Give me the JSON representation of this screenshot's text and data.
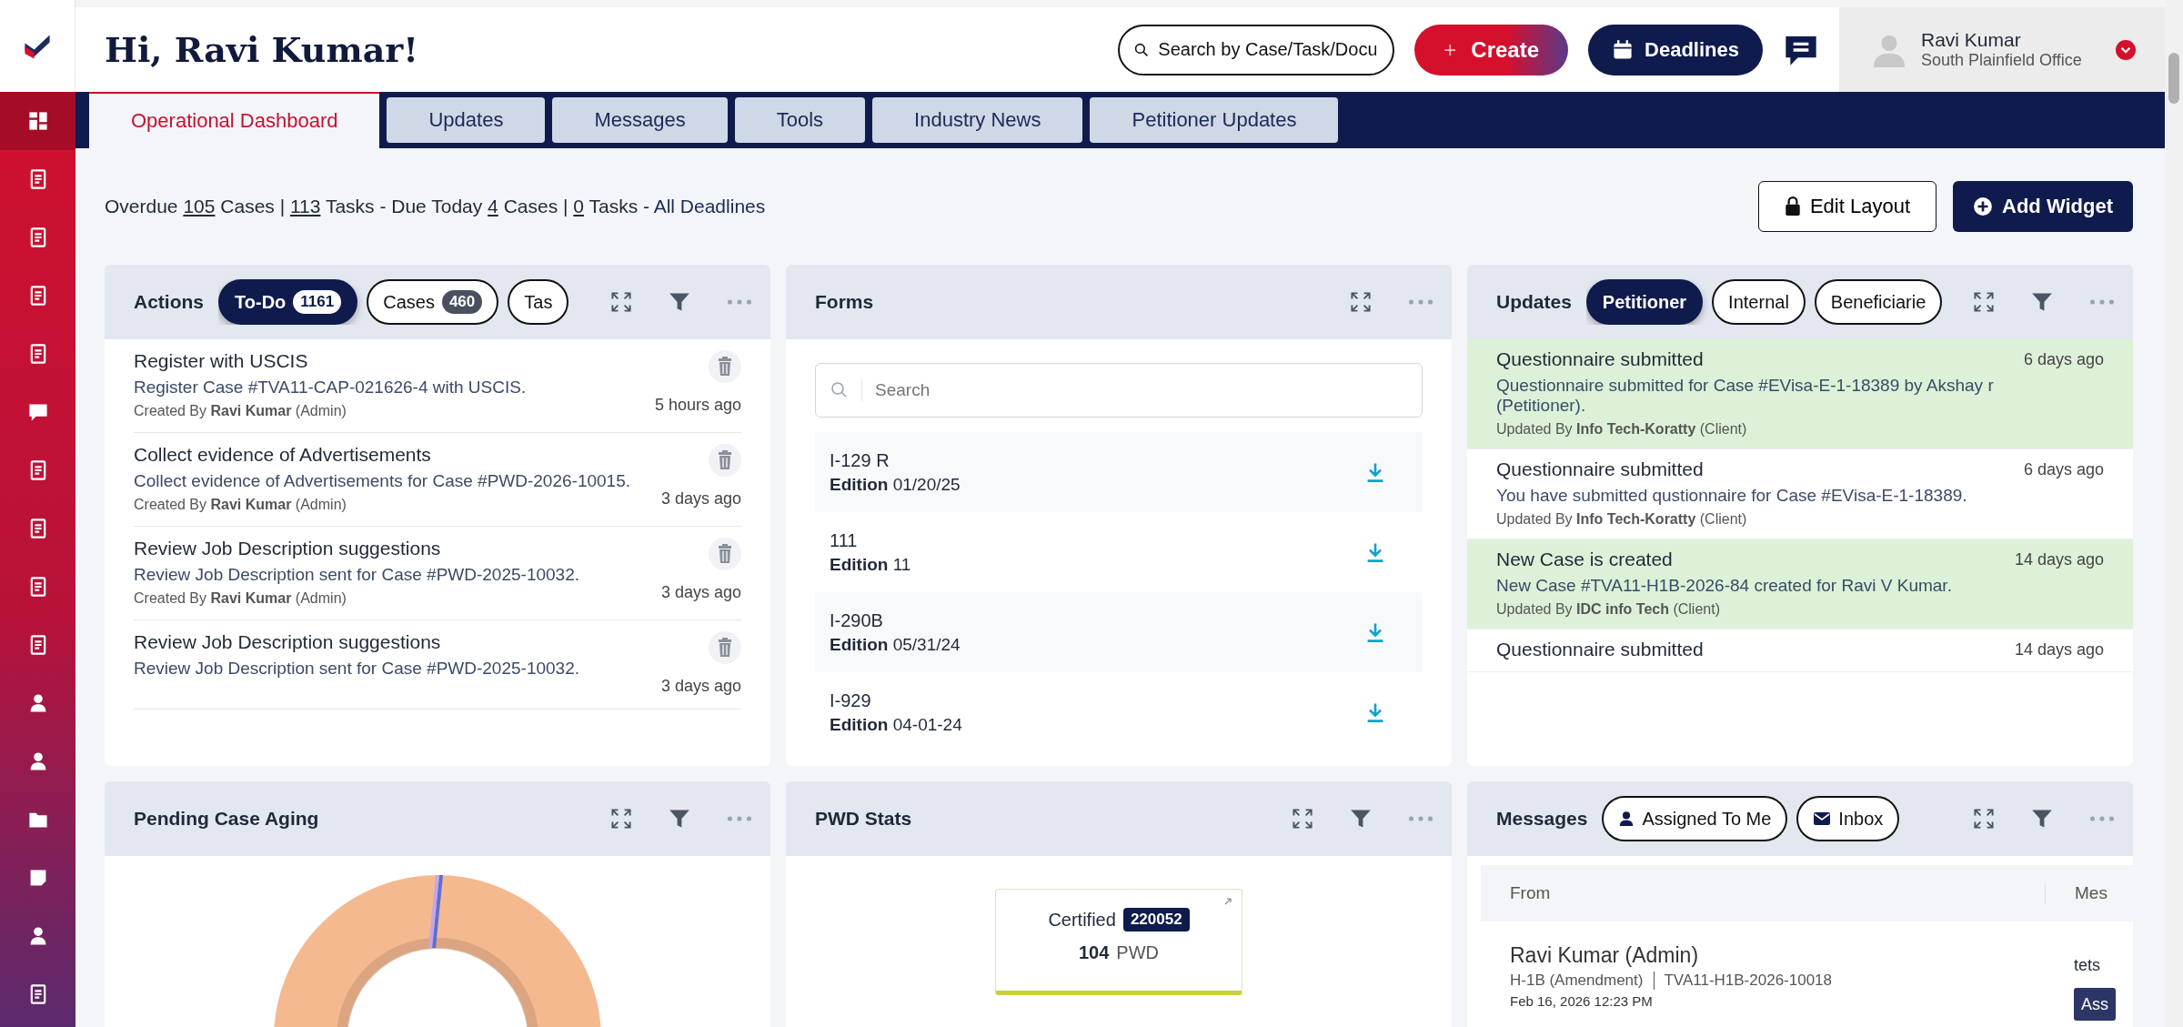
{
  "sidebar": {
    "items": [
      {
        "selected": true
      },
      {
        "selected": false
      },
      {
        "selected": false
      },
      {
        "selected": false
      },
      {
        "selected": false
      },
      {
        "selected": false
      },
      {
        "selected": false
      },
      {
        "selected": false
      },
      {
        "selected": false
      },
      {
        "selected": false
      },
      {
        "selected": false
      },
      {
        "selected": false
      },
      {
        "selected": false
      },
      {
        "selected": false
      },
      {
        "selected": false
      },
      {
        "selected": false
      }
    ]
  },
  "header": {
    "greeting": "Hi, Ravi Kumar!",
    "search": {
      "placeholder": "Search by Case/Task/Docu"
    },
    "create": "Create",
    "create_icon": "+",
    "deadlines": "Deadlines",
    "user": {
      "name": "Ravi Kumar",
      "office": "South Plainfield Office"
    }
  },
  "tabs": [
    {
      "label": "Operational Dashboard",
      "selected": true
    },
    {
      "label": "Updates",
      "selected": false
    },
    {
      "label": "Messages",
      "selected": false
    },
    {
      "label": "Tools",
      "selected": false
    },
    {
      "label": "Industry News",
      "selected": false
    },
    {
      "label": "Petitioner Updates",
      "selected": false
    }
  ],
  "summary": [
    {
      "kind": "text",
      "text": "Overdue"
    },
    {
      "kind": "count",
      "text": "105"
    },
    {
      "kind": "text",
      "text": "Cases |"
    },
    {
      "kind": "count",
      "text": "113"
    },
    {
      "kind": "text",
      "text": "Tasks - Due Today"
    },
    {
      "kind": "count",
      "text": "4"
    },
    {
      "kind": "text",
      "text": "Cases |"
    },
    {
      "kind": "count",
      "text": "0"
    },
    {
      "kind": "text",
      "text": "Tasks -"
    },
    {
      "kind": "link",
      "text": "All Deadlines"
    }
  ],
  "toolbar": {
    "edit_layout": "Edit Layout",
    "add_widget": "Add Widget"
  },
  "widgets": [
    {
      "kind": "actions",
      "title": "Actions",
      "filter": true,
      "pills": [
        {
          "label": "To-Do",
          "count": "1161",
          "selected": true
        },
        {
          "label": "Cases",
          "count": "460",
          "selected": false
        },
        {
          "label": "Tas",
          "selected": false
        }
      ],
      "items": [
        {
          "title": "Register with USCIS",
          "description": "Register Case #TVA11-CAP-021626-4 with USCIS.",
          "created": "Created By **Ravi Kumar** (Admin)",
          "time": "5 hours ago"
        },
        {
          "title": "Collect evidence of Advertisements",
          "description": "Collect evidence of Advertisements for Case #PWD-2026-10015.",
          "created": "Created By **Ravi Kumar** (Admin)",
          "time": "3 days ago"
        },
        {
          "title": "Review Job Description suggestions",
          "description": "Review Job Description sent for Case #PWD-2025-10032.",
          "created": "Created By **Ravi Kumar** (Admin)",
          "time": "3 days ago"
        },
        {
          "title": "Review Job Description suggestions",
          "description": "Review Job Description sent for Case #PWD-2025-10032.",
          "time": "3 days ago"
        }
      ]
    },
    {
      "kind": "forms",
      "title": "Forms",
      "filter": false,
      "search": {
        "placeholder": "Search"
      },
      "items": [
        {
          "name": "I-129 R",
          "edition_label": "Edition",
          "edition": "01/20/25"
        },
        {
          "name": "111",
          "edition_label": "Edition",
          "edition": "11"
        },
        {
          "name": "I-290B",
          "edition_label": "Edition",
          "edition": "05/31/24"
        },
        {
          "name": "I-929",
          "edition_label": "Edition",
          "edition": "04-01-24"
        }
      ]
    },
    {
      "kind": "updates",
      "title": "Updates",
      "filter": true,
      "pills": [
        {
          "label": "Petitioner",
          "selected": true
        },
        {
          "label": "Internal",
          "selected": false
        },
        {
          "label": "Beneficiarie",
          "selected": false
        }
      ],
      "items": [
        {
          "highlighted": true,
          "title": "Questionnaire submitted",
          "time": "6 days ago",
          "description": "Questionnaire submitted for Case #EVisa-E-1-18389 by Akshay r (Petitioner).",
          "updated": "Updated By **Info Tech-Koratty** (Client)"
        },
        {
          "highlighted": false,
          "title": "Questionnaire submitted",
          "time": "6 days ago",
          "description": "You have submitted qustionnaire for Case #EVisa-E-1-18389.",
          "updated": "Updated By **Info Tech-Koratty** (Client)"
        },
        {
          "highlighted": true,
          "title": "New Case is created",
          "time": "14 days ago",
          "description": "New Case #TVA11-H1B-2026-84 created for Ravi V Kumar.",
          "updated": "Updated By **IDC info Tech** (Client)"
        },
        {
          "highlighted": false,
          "title": "Questionnaire submitted",
          "time": "14 days ago"
        }
      ]
    },
    {
      "kind": "aging",
      "title": "Pending Case Aging",
      "filter": true
    },
    {
      "kind": "pwd",
      "title": "PWD Stats",
      "filter": true,
      "card": {
        "label": "Certified",
        "badge": "220052",
        "count": "104",
        "unit": "PWD"
      }
    },
    {
      "kind": "messages",
      "title": "Messages",
      "filter": true,
      "pills": [
        {
          "label": "Assigned To Me",
          "selected": false
        },
        {
          "label": "Inbox",
          "selected": false
        }
      ],
      "table": {
        "columns": [
          "From",
          "Mes"
        ],
        "rows": [
          {
            "from": "Ravi Kumar (Admin)",
            "type": "H-1B (Amendment)",
            "case": "TVA11-H1B-2026-10018",
            "date": "Feb 16, 2026 12:23 PM",
            "message": "tets",
            "action": "Ass"
          }
        ]
      }
    }
  ]
}
